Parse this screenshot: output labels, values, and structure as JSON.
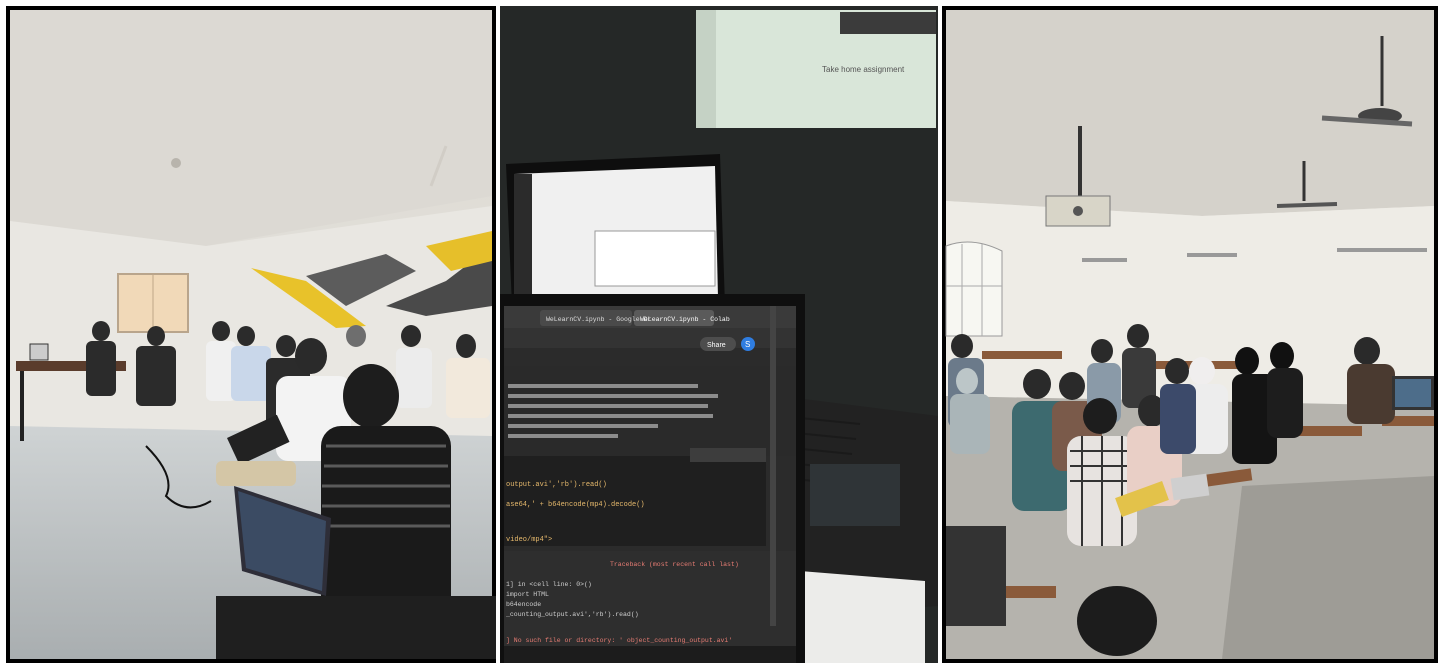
{
  "collage": {
    "panels": [
      {
        "scene": "workshop-room-seated-audience"
      },
      {
        "scene": "laptop-code-notebook-closeup"
      },
      {
        "scene": "classroom-with-students-at-desks"
      }
    ]
  },
  "screen": {
    "tab_1": "WeLearnCV.ipynb - Google Dr",
    "tab_2": "WeLearnCV.ipynb - Colab",
    "share_label": "Share",
    "avatar_letter": "S",
    "error_header": "Traceback (most recent call last)",
    "code_read": "output.avi','rb').read()",
    "code_decode": "ase64,' + b64encode(mp4).decode()",
    "code_video": "video/mp4\">",
    "code_cell": "1] in <cell line: 0>()",
    "code_import": "import HTML",
    "code_b64": "b64encode",
    "code_counting": "_counting_output.avi','rb').read()",
    "code_error": "] No such file or directory: ' object_counting_output.avi'",
    "assignment_title": "Take home assignment"
  },
  "colors": {
    "frame": "#000000",
    "room_wall": "#e7e4dd",
    "yellow_stripe": "#e8c22a",
    "screen_bg": "#2b2b2b",
    "keyboard_glow": "#ff3b3b"
  }
}
